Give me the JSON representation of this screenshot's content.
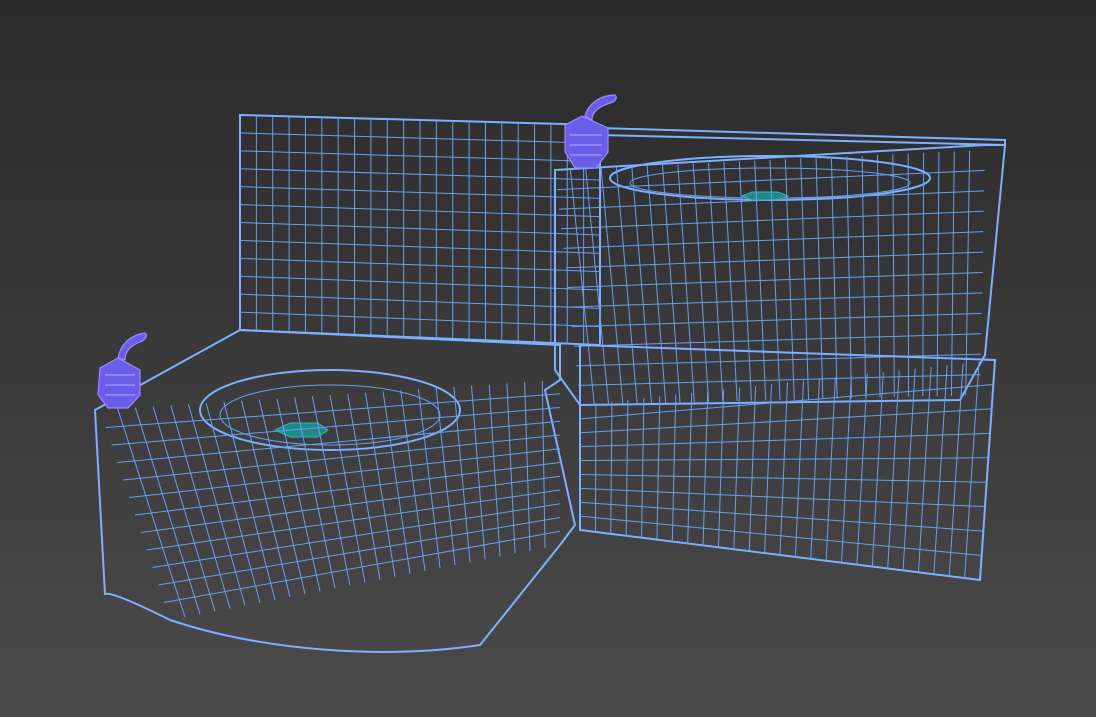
{
  "viewport": {
    "background_top": "#2a2a2a",
    "background_bottom": "#4b4b4b",
    "wire_color": "#6a9ff0",
    "bubbler_color": "#6a5ee8",
    "drain_color": "#1f8a8a"
  },
  "objects": [
    {
      "name": "high-basin",
      "kind": "drinking fountain bowl"
    },
    {
      "name": "low-basin",
      "kind": "drinking fountain bowl"
    },
    {
      "name": "back-panel",
      "kind": "wall panel"
    },
    {
      "name": "left-bubbler",
      "kind": "spout",
      "icon": "bubbler-icon"
    },
    {
      "name": "right-bubbler",
      "kind": "spout",
      "icon": "bubbler-icon"
    }
  ]
}
